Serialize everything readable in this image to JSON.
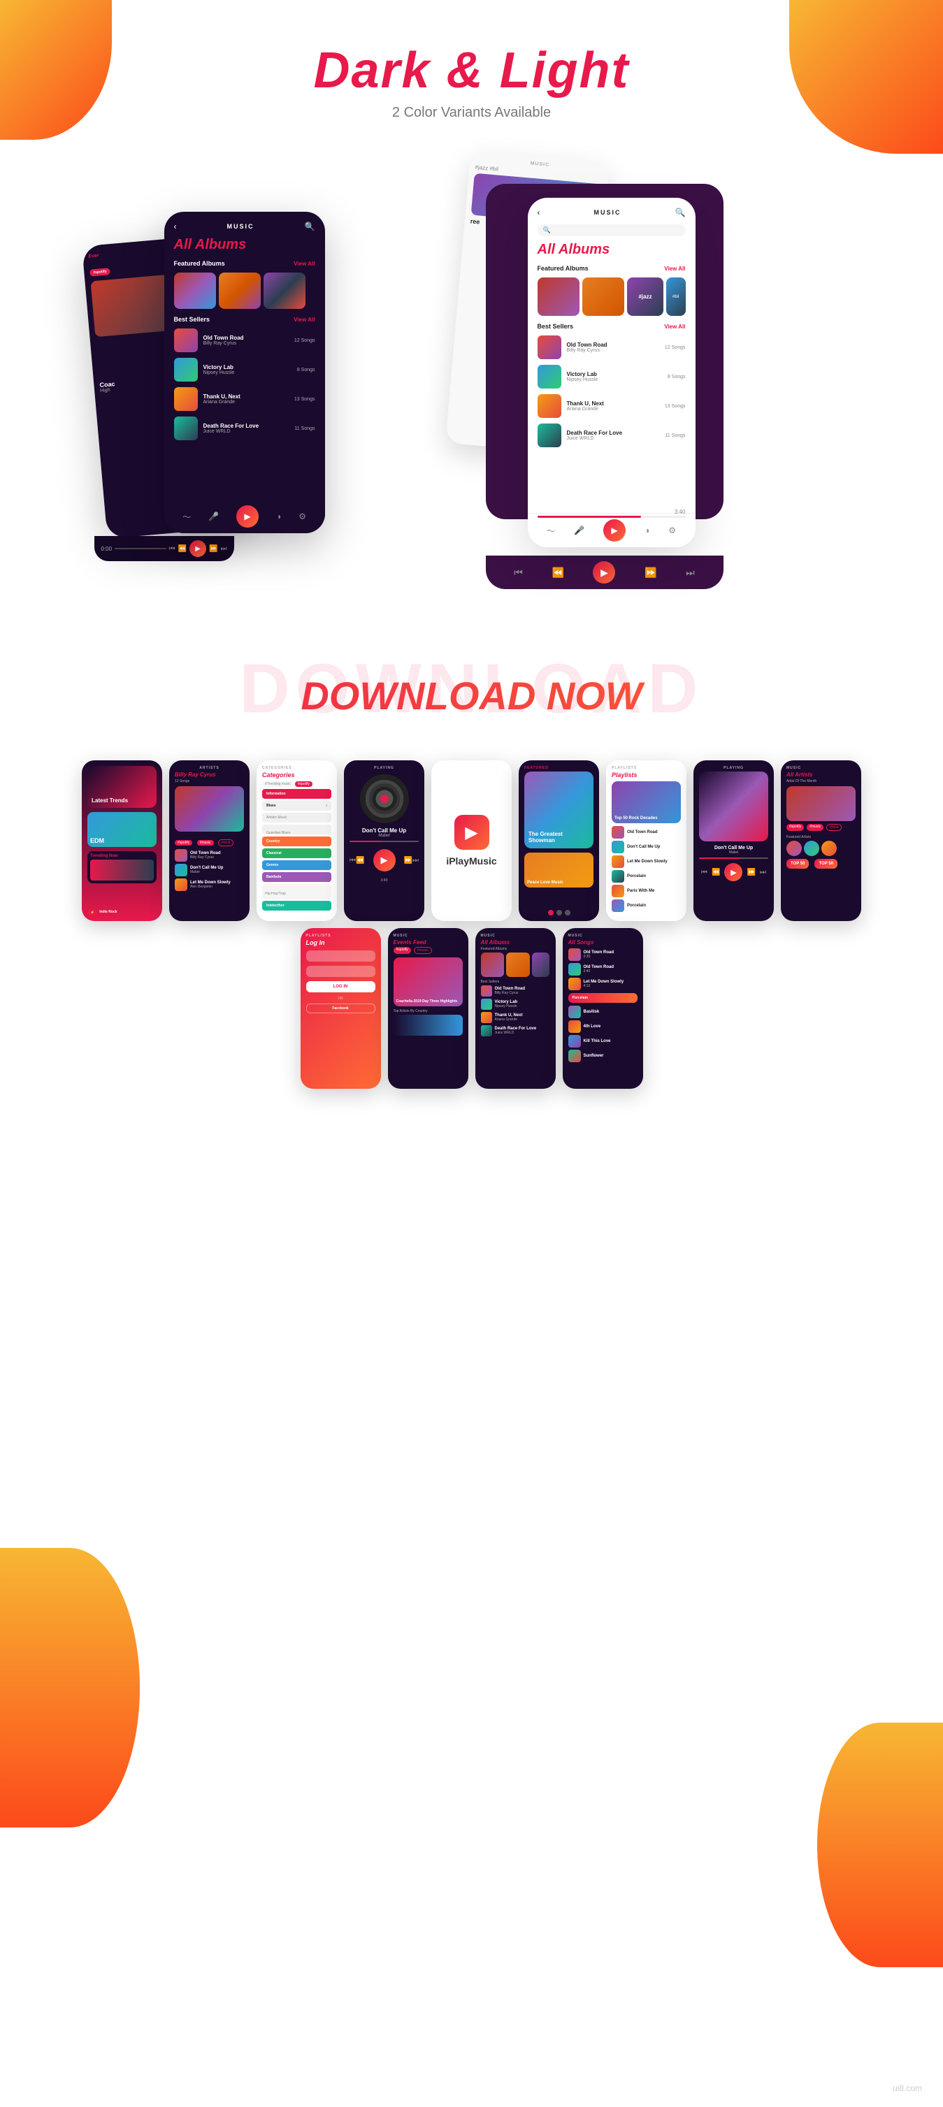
{
  "hero": {
    "title": "Dark & Light",
    "subtitle": "2 Color Variants Available"
  },
  "download": {
    "title": "DOWNLOAD NOW",
    "bg_text": "DOWNLOAD"
  },
  "dark_phone": {
    "header_title": "MUSIC",
    "all_albums": "All Albums",
    "featured_label": "Featured Albums",
    "view_all_1": "View All",
    "best_sellers_label": "Best Sellers",
    "view_all_2": "View All",
    "songs": [
      {
        "title": "Old Town Road",
        "artist": "Billy Ray Cyrus",
        "songs": "12 Songs"
      },
      {
        "title": "Victory Lab",
        "artist": "Nipsey Hussle",
        "songs": "8 Songs"
      },
      {
        "title": "Thank U, Next",
        "artist": "Ariana Grande",
        "songs": "13 Songs"
      },
      {
        "title": "Death Race For Love",
        "artist": "Juice WRLD",
        "songs": "11 Songs"
      }
    ],
    "time_start": "0:00"
  },
  "light_phone": {
    "header_title": "MUSIC",
    "all_albums": "All Albums",
    "featured_label": "Featured Albums",
    "view_all_1": "View All",
    "best_sellers_label": "Best Sellers",
    "view_all_2": "View All",
    "songs": [
      {
        "title": "Old Town Road",
        "artist": "Billy Ray Cyrus",
        "songs": "12 Songs"
      },
      {
        "title": "Victory Lab",
        "artist": "Nipsey Hussle",
        "songs": "8 Songs"
      },
      {
        "title": "Thank U, Next",
        "artist": "Ariana Grande",
        "songs": "13 Songs"
      },
      {
        "title": "Death Race For Love",
        "artist": "Juice WRLD",
        "songs": "11 Songs"
      }
    ],
    "time_end": "3:40"
  },
  "mini_screens": {
    "screen1_title": "Latest Trends",
    "screen1_genre": "EDM",
    "screen2_title": "Billy Ray Cyrus",
    "screen3_title": "Categories",
    "screen4_title": "PLAYING",
    "screen5_logo": "iPlayMusic",
    "screen6_title": "Featured",
    "screen7_title": "Playlists",
    "screen8_title": "PLAYING",
    "screen9_title": "All Artists",
    "screen10_title": "Log In",
    "screen11_title": "Events Feed",
    "screen12_title": "All Albums",
    "screen13_title": "All Songs",
    "categories": [
      "Information",
      "Blues",
      "Country",
      "Classical",
      "Genres",
      "Bambula",
      "Hip-Hop/Trap",
      "Intelecthor"
    ],
    "playlist1": "Top 50 Rock Decades",
    "playlist2": "Old Town Road",
    "playlist3": "Don't Call Me Up",
    "album_songs_list": [
      "Old Town Road",
      "Old Town Road",
      "Victory Lab",
      "Thank U, Next",
      "Death Race For Love"
    ],
    "top50_labels": [
      "TOP 50",
      "TOP 50"
    ],
    "artist_of_month": "Artist Of The Month",
    "concert": "Coachella 2019 Day Three Highlights",
    "dont_call": "Don't Call Me Up",
    "greatest_showman": "The Greatest Showman",
    "peace_love": "Peace Love Music",
    "indie_rock": "Indie Rock",
    "trending_now": "Trending Now"
  },
  "watermark": "ui8.com"
}
